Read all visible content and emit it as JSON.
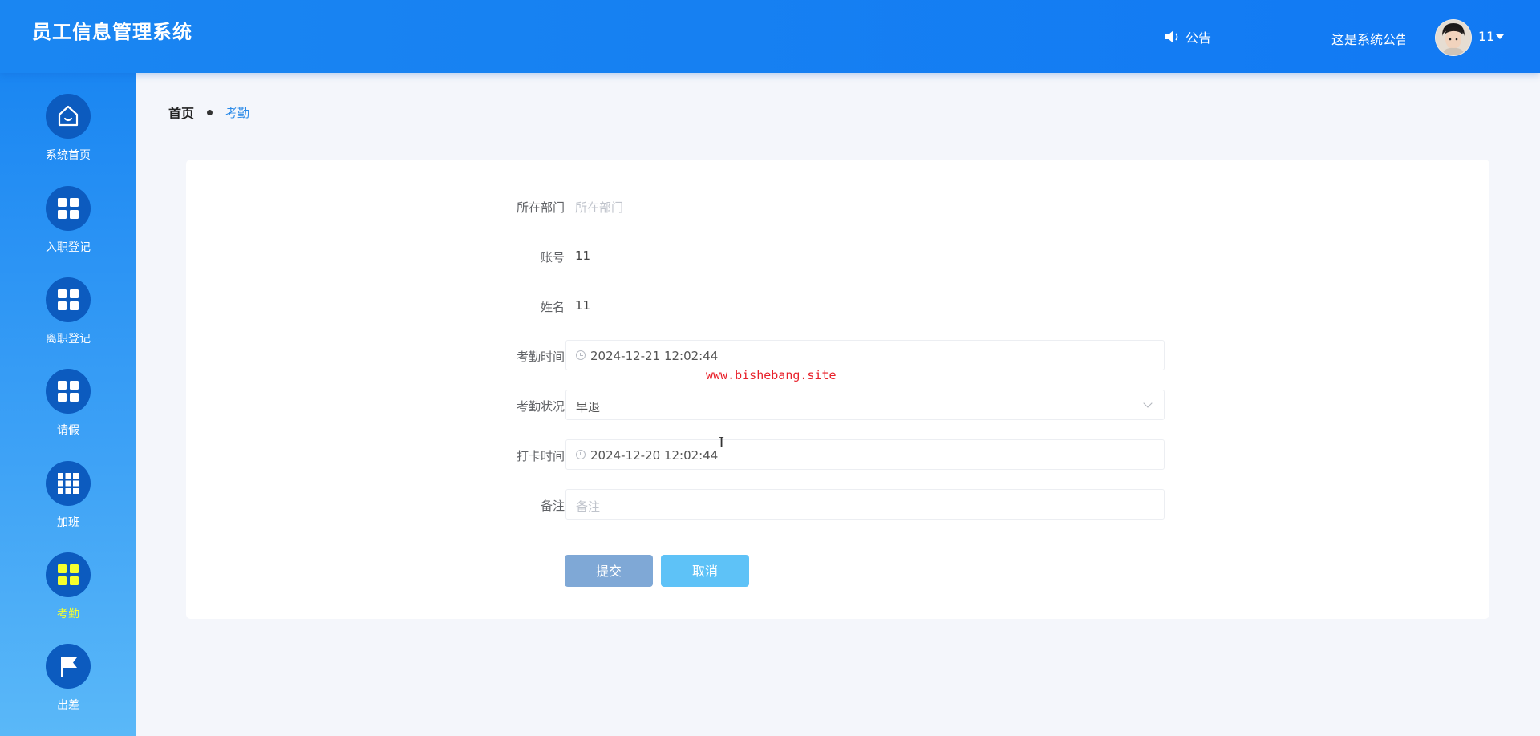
{
  "header": {
    "title": "员工信息管理系统",
    "notice_label": "公告",
    "notice_text": "这是系统公告",
    "user_name": "11"
  },
  "sidebar": {
    "items": [
      {
        "label": "系统首页",
        "icon": "home-icon"
      },
      {
        "label": "入职登记",
        "icon": "grid-icon"
      },
      {
        "label": "离职登记",
        "icon": "grid-icon"
      },
      {
        "label": "请假",
        "icon": "grid-icon"
      },
      {
        "label": "加班",
        "icon": "grid-nine-icon"
      },
      {
        "label": "考勤",
        "icon": "grid-icon",
        "active": true
      },
      {
        "label": "出差",
        "icon": "flag-icon"
      }
    ],
    "active_label_color": "#f5ff2d"
  },
  "breadcrumb": {
    "home": "首页",
    "current": "考勤"
  },
  "form": {
    "department": {
      "label": "所在部门",
      "placeholder": "所在部门"
    },
    "account": {
      "label": "账号",
      "value": "11"
    },
    "name": {
      "label": "姓名",
      "value": "11"
    },
    "attendance_time": {
      "label": "考勤时间",
      "value": "2024-12-21 12:02:44"
    },
    "attendance_status": {
      "label": "考勤状况",
      "value": "早退"
    },
    "clock_time": {
      "label": "打卡时间",
      "value": "2024-12-20 12:02:44"
    },
    "remark": {
      "label": "备注",
      "placeholder": "备注"
    },
    "submit_label": "提交",
    "cancel_label": "取消"
  },
  "watermark": "www.bishebang.site",
  "colors": {
    "header_blue": "#1a86f2",
    "sidebar_icon_bg": "#0c5bbf",
    "breadcrumb_active": "#2a8ae8",
    "submit_button": "#7fa8d6",
    "cancel_button": "#5ec2f7"
  }
}
